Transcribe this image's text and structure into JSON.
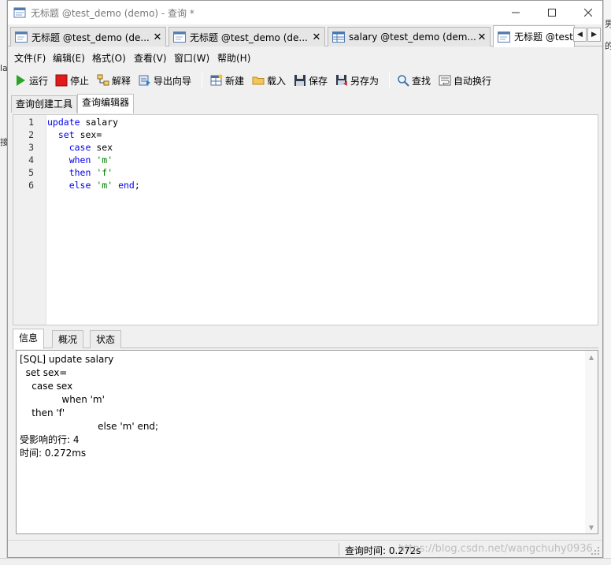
{
  "window": {
    "title": "无标题 @test_demo (demo) - 查询 *"
  },
  "doc_tabs": [
    {
      "label": "无标题 @test_demo (de...",
      "close": "✕",
      "icon": "query-icon",
      "active": false
    },
    {
      "label": "无标题 @test_demo (de...",
      "close": "✕",
      "icon": "query-icon",
      "active": false
    },
    {
      "label": "salary @test_demo (dem...",
      "close": "✕",
      "icon": "table-icon",
      "active": false
    },
    {
      "label": "无标题 @test",
      "close": "",
      "icon": "query-icon",
      "active": true
    }
  ],
  "tab_scroll": {
    "left": "◀",
    "right": "▶"
  },
  "menu": [
    {
      "label": "文件(F)"
    },
    {
      "label": "编辑(E)"
    },
    {
      "label": "格式(O)"
    },
    {
      "label": "查看(V)"
    },
    {
      "label": "窗口(W)"
    },
    {
      "label": "帮助(H)"
    }
  ],
  "toolbar": {
    "run": "运行",
    "stop": "停止",
    "explain": "解释",
    "export_wizard": "导出向导",
    "new": "新建",
    "load": "载入",
    "save": "保存",
    "save_as": "另存为",
    "find": "查找",
    "word_wrap": "自动换行"
  },
  "sub_tabs": {
    "builder": "查询创建工具",
    "editor": "查询编辑器"
  },
  "editor": {
    "line_numbers": [
      "1",
      "2",
      "3",
      "4",
      "5",
      "6"
    ],
    "lines": [
      {
        "k1": "update",
        "t1": " salary"
      },
      {
        "ind": "  ",
        "k1": "set",
        "t1": " sex="
      },
      {
        "ind": "    ",
        "k1": "case",
        "t1": " sex"
      },
      {
        "ind": "    ",
        "k1": "when",
        "s1": "'m'"
      },
      {
        "ind": "    ",
        "k1": "then",
        "s1": "'f'"
      },
      {
        "ind": "    ",
        "k1": "else",
        "s1": "'m'",
        "k2": "end",
        "t2": ";"
      }
    ]
  },
  "result_tabs": {
    "info": "信息",
    "profile": "概况",
    "status": "状态"
  },
  "messages": [
    "[SQL] update salary",
    "  set sex=",
    "    case sex",
    "              when 'm'",
    "    then 'f'",
    "                          else 'm' end;",
    "受影响的行: 4",
    "时间: 0.272ms"
  ],
  "status_bar": {
    "query_time": "查询时间: 0.272s",
    "watermark": "https://blog.csdn.net/wangchuhy0936"
  },
  "background": {
    "left_fragments": [
      "la",
      "接"
    ],
    "right_fragments": [
      "男",
      "的"
    ]
  },
  "colors": {
    "keyword": "#0000ee",
    "string": "#008000",
    "run_green": "#2aa52a",
    "stop_red": "#e11b1b"
  }
}
